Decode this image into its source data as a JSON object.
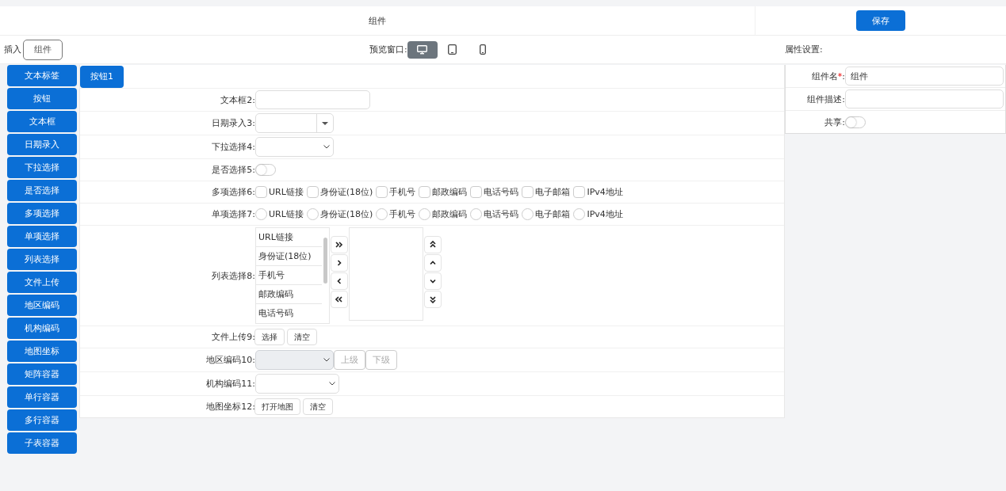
{
  "header": {
    "title": "组件",
    "save_button": "保存"
  },
  "toolbar": {
    "insert_label": "插入",
    "insert_button": "组件",
    "preview_label": "预览窗口:",
    "preview_devices": [
      {
        "kind": "desktop",
        "selected": true
      },
      {
        "kind": "tablet",
        "selected": false
      },
      {
        "kind": "phone",
        "selected": false
      }
    ],
    "properties_label": "属性设置:"
  },
  "palette": [
    "文本标签",
    "按钮",
    "文本框",
    "日期录入",
    "下拉选择",
    "是否选择",
    "多项选择",
    "单项选择",
    "列表选择",
    "文件上传",
    "地区编码",
    "机构编码",
    "地图坐标",
    "矩阵容器",
    "单行容器",
    "多行容器",
    "子表容器"
  ],
  "canvas": {
    "button": "按钮1",
    "fields": [
      {
        "kind": "text",
        "label": "文本框2:"
      },
      {
        "kind": "date",
        "label": "日期录入3:"
      },
      {
        "kind": "select",
        "label": "下拉选择4:"
      },
      {
        "kind": "switch",
        "label": "是否选择5:",
        "on": false
      },
      {
        "kind": "checkbox_group",
        "label": "多项选择6:",
        "options": [
          {
            "label": "URL链接",
            "checked": false
          },
          {
            "label": "身份证(18位)",
            "checked": false
          },
          {
            "label": "手机号",
            "checked": false
          },
          {
            "label": "邮政编码",
            "checked": false
          },
          {
            "label": "电话号码",
            "checked": false
          },
          {
            "label": "电子邮箱",
            "checked": false
          },
          {
            "label": "IPv4地址",
            "checked": false
          }
        ]
      },
      {
        "kind": "radio_group",
        "label": "单项选择7:",
        "options": [
          {
            "label": "URL链接",
            "selected": false
          },
          {
            "label": "身份证(18位)",
            "selected": false
          },
          {
            "label": "手机号",
            "selected": false
          },
          {
            "label": "邮政编码",
            "selected": false
          },
          {
            "label": "电话号码",
            "selected": false
          },
          {
            "label": "电子邮箱",
            "selected": false
          },
          {
            "label": "IPv4地址",
            "selected": false
          }
        ]
      },
      {
        "kind": "transfer",
        "label": "列表选择8:",
        "options": [
          "URL链接",
          "身份证(18位)",
          "手机号",
          "邮政编码",
          "电话号码"
        ]
      },
      {
        "kind": "buttons",
        "label": "文件上传9:",
        "buttons": [
          {
            "label": "选择",
            "disabled": false
          },
          {
            "label": "清空",
            "disabled": false
          }
        ]
      },
      {
        "kind": "region",
        "label": "地区编码10:",
        "disabled": true,
        "buttons": [
          {
            "label": "上级",
            "disabled": true
          },
          {
            "label": "下级",
            "disabled": true
          }
        ]
      },
      {
        "kind": "select",
        "label": "机构编码11:"
      },
      {
        "kind": "buttons",
        "label": "地图坐标12:",
        "buttons": [
          {
            "label": "打开地图",
            "disabled": false
          },
          {
            "label": "清空",
            "disabled": false
          }
        ]
      }
    ]
  },
  "properties": {
    "fields": [
      {
        "kind": "text",
        "label": "组件名",
        "required_mark": "*",
        "suffix": ":",
        "value": "组件"
      },
      {
        "kind": "text",
        "label": "组件描述",
        "suffix": ":"
      },
      {
        "kind": "switch",
        "label": "共享",
        "suffix": ":",
        "on": false
      }
    ]
  }
}
